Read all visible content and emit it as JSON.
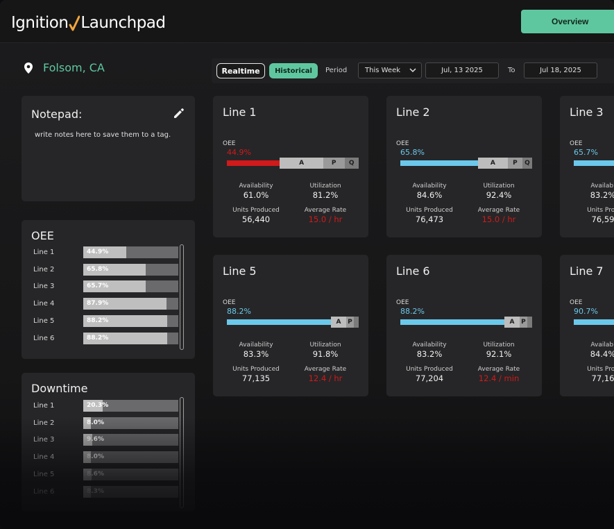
{
  "header": {
    "logo_left": "Ignition",
    "logo_right": "Launchpad",
    "overview_label": "Overview"
  },
  "location": {
    "label": "Folsom, CA",
    "icon": "map-pin-icon"
  },
  "toolbar": {
    "realtime_label": "Realtime",
    "historical_label": "Historical",
    "period_label": "Period",
    "period_value": "This Week",
    "start_date": "Jul, 13 2025",
    "to_label": "To",
    "end_date": "Jul 18, 2025"
  },
  "notepad": {
    "title": "Notepad:",
    "text": "write notes here to save them to a tag."
  },
  "oee_panel": {
    "title": "OEE",
    "rows": [
      {
        "label": "Line 1",
        "value": "44.9%",
        "fraction": 0.449
      },
      {
        "label": "Line 2",
        "value": "65.8%",
        "fraction": 0.658
      },
      {
        "label": "Line 3",
        "value": "65.7%",
        "fraction": 0.657
      },
      {
        "label": "Line 4",
        "value": "87.9%",
        "fraction": 0.879
      },
      {
        "label": "Line 5",
        "value": "88.2%",
        "fraction": 0.882
      },
      {
        "label": "Line 6",
        "value": "88.2%",
        "fraction": 0.882
      }
    ]
  },
  "downtime_panel": {
    "title": "Downtime",
    "rows": [
      {
        "label": "Line 1",
        "value": "20.3%",
        "fraction": 0.203
      },
      {
        "label": "Line 2",
        "value": "8.0%",
        "fraction": 0.08
      },
      {
        "label": "Line 3",
        "value": "9.6%",
        "fraction": 0.096
      },
      {
        "label": "Line 4",
        "value": "8.0%",
        "fraction": 0.08
      },
      {
        "label": "Line 5",
        "value": "8.6%",
        "fraction": 0.086
      },
      {
        "label": "Line 6",
        "value": "8.3%",
        "fraction": 0.083
      }
    ]
  },
  "cards": [
    {
      "title": "Line 1",
      "oee_label": "OEE",
      "oee": "44.9%",
      "oee_fraction": 0.449,
      "oee_color": "#d11a1a",
      "availability_label": "Availability",
      "availability": "61.0%",
      "utilization_label": "Utilization",
      "utilization": "81.2%",
      "units_label": "Units Produced",
      "units": "56,440",
      "rate_label": "Average Rate",
      "rate": "15.0 / hr",
      "seg_a": "A",
      "seg_p": "P",
      "seg_q": "Q"
    },
    {
      "title": "Line 2",
      "oee_label": "OEE",
      "oee": "65.8%",
      "oee_fraction": 0.658,
      "oee_color": "#6cc8ea",
      "availability_label": "Availability",
      "availability": "84.6%",
      "utilization_label": "Utilization",
      "utilization": "92.4%",
      "units_label": "Units Produced",
      "units": "76,473",
      "rate_label": "Average Rate",
      "rate": "15.0 / hr",
      "seg_a": "A",
      "seg_p": "P",
      "seg_q": "Q"
    },
    {
      "title": "Line 3",
      "oee_label": "OEE",
      "oee": "65.7%",
      "oee_fraction": 0.657,
      "oee_color": "#6cc8ea",
      "availability_label": "Availabi",
      "availability": "83.2%",
      "utilization_label": "",
      "utilization": "",
      "units_label": "Units Prod",
      "units": "76,59",
      "rate_label": "",
      "rate": "",
      "seg_a": "",
      "seg_p": "",
      "seg_q": ""
    },
    {
      "title": "Line 5",
      "oee_label": "OEE",
      "oee": "88.2%",
      "oee_fraction": 0.882,
      "oee_color": "#6cc8ea",
      "availability_label": "Availability",
      "availability": "83.3%",
      "utilization_label": "Utilization",
      "utilization": "91.8%",
      "units_label": "Units Produced",
      "units": "77,135",
      "rate_label": "Average Rate",
      "rate": "12.4 / hr",
      "seg_a": "A",
      "seg_p": "P",
      "seg_q": ""
    },
    {
      "title": "Line 6",
      "oee_label": "OEE",
      "oee": "88.2%",
      "oee_fraction": 0.882,
      "oee_color": "#6cc8ea",
      "availability_label": "Availability",
      "availability": "83.2%",
      "utilization_label": "Utilization",
      "utilization": "92.1%",
      "units_label": "Units Produced",
      "units": "77,204",
      "rate_label": "Average Rate",
      "rate": "12.4 / min",
      "seg_a": "A",
      "seg_p": "P",
      "seg_q": ""
    },
    {
      "title": "Line 7",
      "oee_label": "OEE",
      "oee": "90.7%",
      "oee_fraction": 0.907,
      "oee_color": "#6cc8ea",
      "availability_label": "Availabi",
      "availability": "84.4%",
      "utilization_label": "",
      "utilization": "",
      "units_label": "Units Prod",
      "units": "77,16",
      "rate_label": "",
      "rate": "",
      "seg_a": "",
      "seg_p": "",
      "seg_q": ""
    }
  ],
  "colors": {
    "accent": "#5fc79f",
    "alert": "#d11a1a",
    "oee_good": "#6cc8ea",
    "panel": "#262628"
  }
}
